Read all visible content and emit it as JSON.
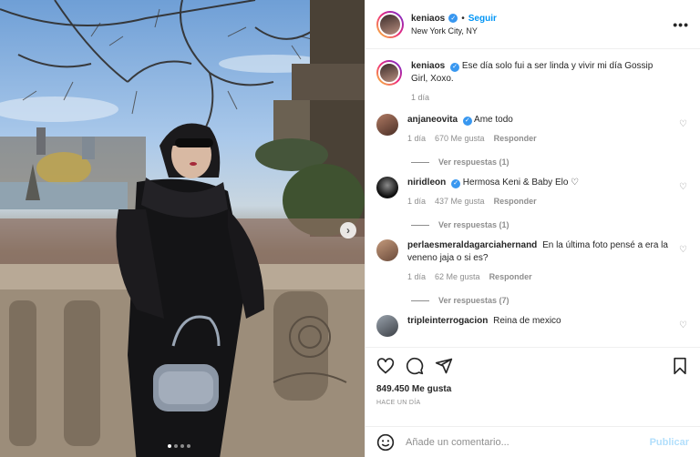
{
  "header": {
    "username": "keniaos",
    "separator": "•",
    "follow_label": "Seguir",
    "location": "New York City, NY",
    "more_label": "•••"
  },
  "caption": {
    "username": "keniaos",
    "text": "Ese día solo fui a ser linda y vivir mi día Gossip Girl, Xoxo.",
    "time": "1 día"
  },
  "comments": [
    {
      "username": "anjaneovita",
      "verified": true,
      "text": "Ame todo",
      "time": "1 día",
      "likes": "670 Me gusta",
      "reply": "Responder",
      "view_replies": "Ver respuestas (1)"
    },
    {
      "username": "niridleon",
      "verified": true,
      "text": "Hermosa Keni & Baby Elo ♡",
      "time": "1 día",
      "likes": "437 Me gusta",
      "reply": "Responder",
      "view_replies": "Ver respuestas (1)"
    },
    {
      "username": "perlaesmeraldagarciahernand",
      "verified": false,
      "text": "En la última foto pensé a era la veneno jaja o si es?",
      "time": "1 día",
      "likes": "62 Me gusta",
      "reply": "Responder",
      "view_replies": "Ver respuestas (7)"
    },
    {
      "username": "tripleinterrogacion",
      "verified": false,
      "text": "Reina de mexico"
    }
  ],
  "actions": {
    "likes": "849.450 Me gusta",
    "date": "HACE UN DÍA"
  },
  "add_comment": {
    "placeholder": "Añade un comentario...",
    "publish_label": "Publicar"
  },
  "carousel": {
    "next_label": "›",
    "dots": 4,
    "active_dot": 1
  },
  "colors": {
    "accent": "#0095f6",
    "verified": "#3897f0",
    "muted": "#8e8e8e",
    "publish_disabled": "#b2dffc"
  },
  "icons": [
    "verified-icon",
    "more-icon",
    "heart-icon",
    "comment-icon",
    "share-icon",
    "bookmark-icon",
    "emoji-icon",
    "next-arrow-icon"
  ]
}
